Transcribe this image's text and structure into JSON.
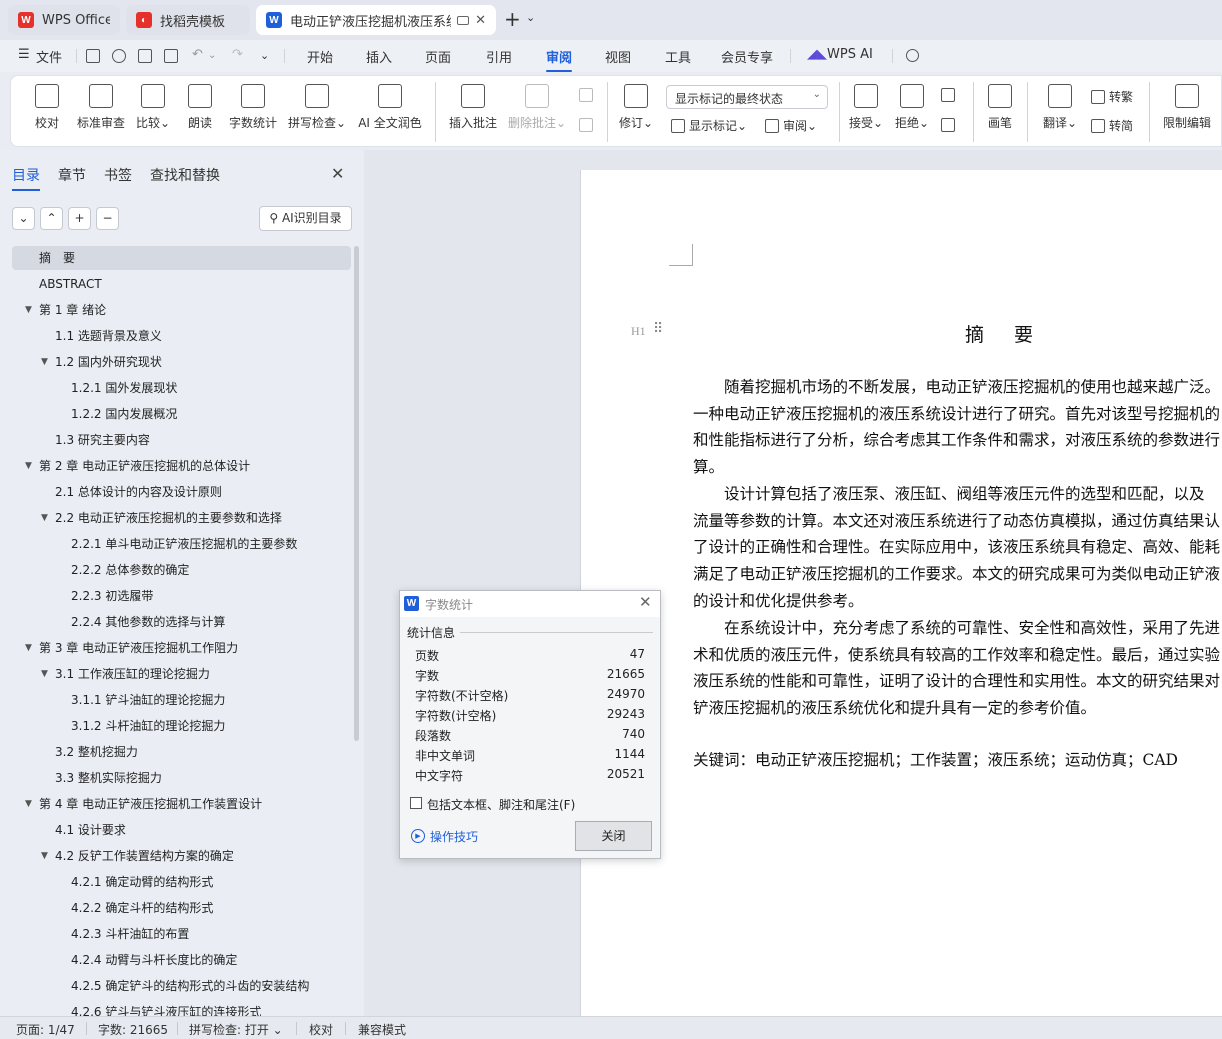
{
  "tabs": [
    {
      "label": "WPS Office",
      "icon": "wps-logo-icon",
      "color": "#e5302b"
    },
    {
      "label": "找稻壳模板",
      "icon": "docer-logo-icon",
      "color": "#e5302b"
    },
    {
      "label": "电动正铲液压挖掘机液压系统",
      "icon": "writer-doc-icon",
      "color": "#1f5fd9"
    }
  ],
  "menu": {
    "file": "文件",
    "items": [
      "开始",
      "插入",
      "页面",
      "引用",
      "审阅",
      "视图",
      "工具",
      "会员专享"
    ],
    "active": "审阅",
    "wps_ai": "WPS AI"
  },
  "ribbon": {
    "proofread": "校对",
    "standard_review": "标准审查",
    "compare": "比较",
    "read_aloud": "朗读",
    "word_count": "字数统计",
    "spell_check": "拼写检查",
    "ai_polish": "AI 全文润色",
    "insert_comment": "插入批注",
    "delete_comment": "删除批注",
    "track_changes": "修订",
    "markup_mode": "显示标记的最终状态",
    "show_markup": "显示标记",
    "review_pane": "审阅",
    "accept": "接受",
    "reject": "拒绝",
    "pen": "画笔",
    "translate": "翻译",
    "to_traditional": "转繁",
    "to_simplified": "转简",
    "restrict_edit": "限制编辑"
  },
  "left_pane": {
    "tabs": [
      "目录",
      "章节",
      "书签",
      "查找和替换"
    ],
    "ai_toc": "AI识别目录",
    "toc": [
      {
        "text": "摘　要",
        "level": 1,
        "arrow": false,
        "selected": true
      },
      {
        "text": "ABSTRACT",
        "level": 1,
        "arrow": false
      },
      {
        "text": "第 1 章  绪论",
        "level": 1,
        "arrow": true
      },
      {
        "text": "1.1  选题背景及意义",
        "level": 2,
        "arrow": false
      },
      {
        "text": "1.2  国内外研究现状",
        "level": 2,
        "arrow": true
      },
      {
        "text": "1.2.1 国外发展现状",
        "level": 3,
        "arrow": false
      },
      {
        "text": "1.2.2 国内发展概况",
        "level": 3,
        "arrow": false
      },
      {
        "text": "1.3  研究主要内容",
        "level": 2,
        "arrow": false
      },
      {
        "text": "第 2 章  电动正铲液压挖掘机的总体设计",
        "level": 1,
        "arrow": true
      },
      {
        "text": "2.1  总体设计的内容及设计原则",
        "level": 2,
        "arrow": false
      },
      {
        "text": "2.2  电动正铲液压挖掘机的主要参数和选择",
        "level": 2,
        "arrow": true
      },
      {
        "text": "2.2.1  单斗电动正铲液压挖掘机的主要参数",
        "level": 3,
        "arrow": false
      },
      {
        "text": "2.2.2  总体参数的确定",
        "level": 3,
        "arrow": false
      },
      {
        "text": "2.2.3 初选履带",
        "level": 3,
        "arrow": false
      },
      {
        "text": "2.2.4 其他参数的选择与计算",
        "level": 3,
        "arrow": false
      },
      {
        "text": "第 3 章  电动正铲液压挖掘机工作阻力",
        "level": 1,
        "arrow": true
      },
      {
        "text": "3.1  工作液压缸的理论挖掘力",
        "level": 2,
        "arrow": true
      },
      {
        "text": "3.1.1 铲斗油缸的理论挖掘力",
        "level": 3,
        "arrow": false
      },
      {
        "text": "3.1.2  斗杆油缸的理论挖掘力",
        "level": 3,
        "arrow": false
      },
      {
        "text": "3.2  整机挖掘力",
        "level": 2,
        "arrow": false
      },
      {
        "text": "3.3  整机实际挖掘力",
        "level": 2,
        "arrow": false
      },
      {
        "text": "第 4 章  电动正铲液压挖掘机工作装置设计",
        "level": 1,
        "arrow": true
      },
      {
        "text": "4.1 设计要求",
        "level": 2,
        "arrow": false
      },
      {
        "text": "4.2 反铲工作装置结构方案的确定",
        "level": 2,
        "arrow": true
      },
      {
        "text": "4.2.1 确定动臂的结构形式",
        "level": 3,
        "arrow": false
      },
      {
        "text": "4.2.2 确定斗杆的结构形式",
        "level": 3,
        "arrow": false
      },
      {
        "text": "4.2.3 斗杆油缸的布置",
        "level": 3,
        "arrow": false
      },
      {
        "text": "4.2.4 动臂与斗杆长度比的确定",
        "level": 3,
        "arrow": false
      },
      {
        "text": "4.2.5 确定铲斗的结构形式的斗齿的安装结构",
        "level": 3,
        "arrow": false
      },
      {
        "text": "4.2.6 铲斗与铲斗液压缸的连接形式",
        "level": 3,
        "arrow": false
      }
    ]
  },
  "document": {
    "heading_marker": "H1",
    "title": "摘 要",
    "paragraphs": [
      [
        "　　随着挖掘机市场的不断发展，电动正铲液压挖掘机的使用也越来越广泛。",
        "一种电动正铲液压挖掘机的液压系统设计进行了研究。首先对该型号挖掘机的",
        "和性能指标进行了分析，综合考虑其工作条件和需求，对液压系统的参数进行",
        "算。"
      ],
      [
        "　　设计计算包括了液压泵、液压缸、阀组等液压元件的选型和匹配，以及",
        "流量等参数的计算。本文还对液压系统进行了动态仿真模拟，通过仿真结果认",
        "了设计的正确性和合理性。在实际应用中，该液压系统具有稳定、高效、能耗",
        "满足了电动正铲液压挖掘机的工作要求。本文的研究成果可为类似电动正铲液",
        "的设计和优化提供参考。"
      ],
      [
        "　　在系统设计中，充分考虑了系统的可靠性、安全性和高效性，采用了先进",
        "术和优质的液压元件，使系统具有较高的工作效率和稳定性。最后，通过实验",
        "液压系统的性能和可靠性，证明了设计的合理性和实用性。本文的研究结果对",
        "铲液压挖掘机的液压系统优化和提升具有一定的参考价值。"
      ]
    ],
    "keywords": "关键词：电动正铲液压挖掘机；工作装置；液压系统；运动仿真；CAD"
  },
  "dialog": {
    "title": "字数统计",
    "group": "统计信息",
    "stats": [
      {
        "label": "页数",
        "value": "47"
      },
      {
        "label": "字数",
        "value": "21665"
      },
      {
        "label": "字符数(不计空格)",
        "value": "24970"
      },
      {
        "label": "字符数(计空格)",
        "value": "29243"
      },
      {
        "label": "段落数",
        "value": "740"
      },
      {
        "label": "非中文单词",
        "value": "1144"
      },
      {
        "label": "中文字符",
        "value": "20521"
      }
    ],
    "include_label": "包括文本框、脚注和尾注(F)",
    "tips": "操作技巧",
    "close": "关闭"
  },
  "status": {
    "page": "页面: 1/47",
    "words": "字数: 21665",
    "spell": "拼写检查: 打开",
    "proof": "校对",
    "compat": "兼容模式"
  }
}
